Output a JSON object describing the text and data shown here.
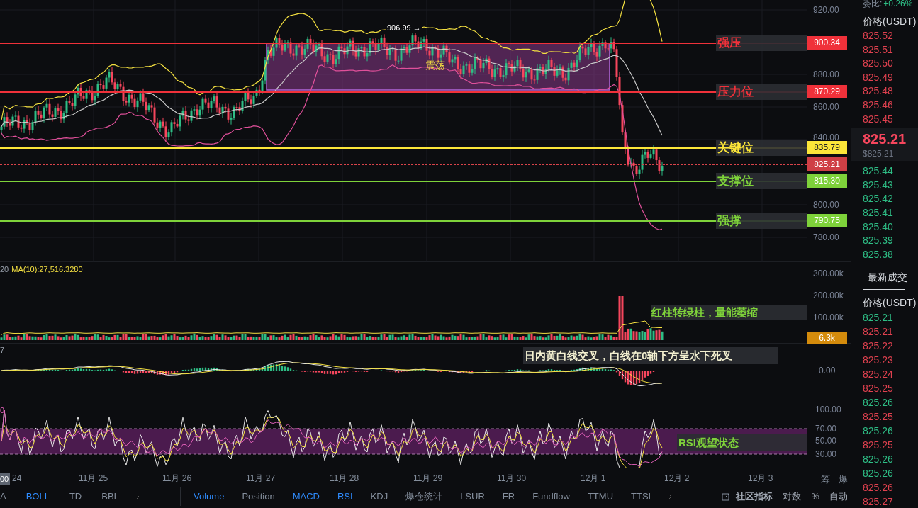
{
  "chart": {
    "price_ticks": [
      "920.00",
      "880.00",
      "860.00",
      "840.00",
      "800.00",
      "780.00"
    ],
    "peak_label": "906.99 →",
    "range_label": "震荡",
    "levels": [
      {
        "label": "强压",
        "price": "900.34",
        "color": "#f0313a"
      },
      {
        "label": "压力位",
        "price": "870.29",
        "color": "#f0313a"
      },
      {
        "label": "关键位",
        "price": "835.79",
        "color": "#fce639"
      },
      {
        "label": "支撑位",
        "price": "815.30",
        "color": "#7ed23a"
      },
      {
        "label": "强撑",
        "price": "790.75",
        "color": "#7ed23a"
      }
    ],
    "current_price": "825.21"
  },
  "volume": {
    "legend": "20",
    "ma": "MA(10):27,516.3280",
    "ticks": [
      "300.00k",
      "200.00k",
      "100.00k"
    ],
    "current": "6.3k",
    "note": "红柱转绿柱，量能萎缩"
  },
  "macd": {
    "legend": "7",
    "ticks": [
      "0.00"
    ],
    "note": "日内黄白线交叉，白线在0轴下方呈水下死叉"
  },
  "rsi": {
    "legend": "0",
    "ticks": [
      "100.00",
      "70.00",
      "50.00",
      "30.00"
    ],
    "note": "RSI观望状态"
  },
  "time_axis": {
    "cursor": "00",
    "dates": [
      "24",
      "11月 25",
      "11月 26",
      "11月 27",
      "11月 28",
      "11月 29",
      "11月 30",
      "12月 1",
      "12月 2",
      "12月 3"
    ],
    "buttons": [
      "筹",
      "爆"
    ]
  },
  "toolbar": {
    "main_indicators": [
      {
        "label": "A",
        "selected": false
      },
      {
        "label": "BOLL",
        "selected": true
      },
      {
        "label": "TD",
        "selected": false
      },
      {
        "label": "BBI",
        "selected": false
      }
    ],
    "sub_indicators": [
      {
        "label": "Volume",
        "selected": true
      },
      {
        "label": "Position",
        "selected": false
      },
      {
        "label": "MACD",
        "selected": true
      },
      {
        "label": "RSI",
        "selected": true
      },
      {
        "label": "KDJ",
        "selected": false
      },
      {
        "label": "爆仓统计",
        "selected": false
      },
      {
        "label": "LSUR",
        "selected": false
      },
      {
        "label": "FR",
        "selected": false
      },
      {
        "label": "Fundflow",
        "selected": false
      },
      {
        "label": "TTMU",
        "selected": false
      },
      {
        "label": "TTSI",
        "selected": false
      }
    ],
    "community": "社区指标",
    "options": [
      "对数",
      "%",
      "自动"
    ]
  },
  "order_book": {
    "ratio_label": "委比:",
    "ratio": "+0.26%",
    "header": "价格(USDT)",
    "asks": [
      "825.52",
      "825.51",
      "825.50",
      "825.49",
      "825.48",
      "825.46",
      "825.45"
    ],
    "last_price": "825.21",
    "last_price_usd": "$825.21",
    "bids": [
      "825.44",
      "825.43",
      "825.42",
      "825.41",
      "825.40",
      "825.39",
      "825.38"
    ]
  },
  "trades": {
    "title": "最新成交",
    "header": "价格(USDT)",
    "rows": [
      {
        "price": "825.21",
        "color": "#2ebd85"
      },
      {
        "price": "825.21",
        "color": "#e0414f"
      },
      {
        "price": "825.22",
        "color": "#e0414f"
      },
      {
        "price": "825.23",
        "color": "#e0414f"
      },
      {
        "price": "825.24",
        "color": "#e0414f"
      },
      {
        "price": "825.25",
        "color": "#e0414f"
      },
      {
        "price": "825.26",
        "color": "#2ebd85"
      },
      {
        "price": "825.25",
        "color": "#e0414f"
      },
      {
        "price": "825.26",
        "color": "#2ebd85"
      },
      {
        "price": "825.25",
        "color": "#e0414f"
      },
      {
        "price": "825.26",
        "color": "#2ebd85"
      },
      {
        "price": "825.26",
        "color": "#2ebd85"
      },
      {
        "price": "825.26",
        "color": "#e0414f"
      },
      {
        "price": "825.27",
        "color": "#e0414f"
      }
    ]
  }
}
